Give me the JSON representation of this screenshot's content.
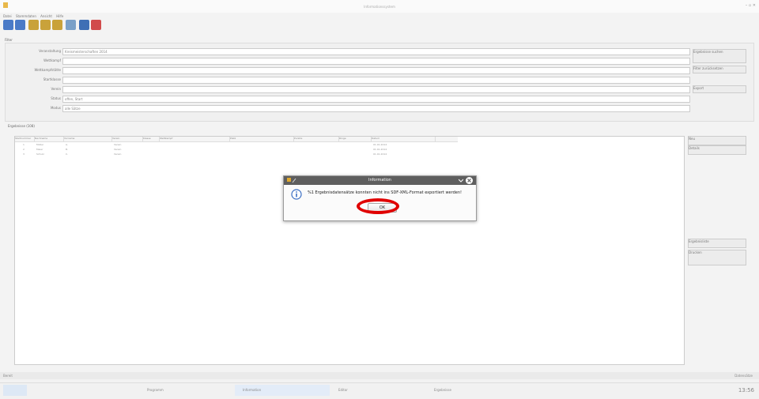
{
  "window": {
    "title": "Informationssystem",
    "controls": "– ▫ ✕"
  },
  "menu": {
    "items": [
      "Datei",
      "Stammdaten",
      "Ansicht",
      "Hilfe"
    ]
  },
  "toolbar": {
    "icons": [
      "arrow-left-icon",
      "arrow-right-icon",
      "trophy-icon",
      "trophy-icon",
      "trophy-icon",
      "edit-icon",
      "save-icon",
      "delete-icon"
    ]
  },
  "filter": {
    "section_label": "Filter",
    "fields": [
      {
        "label": "Veranstaltung",
        "value": "Kreismeisterschaften 2014"
      },
      {
        "label": "Wettkampf",
        "value": ""
      },
      {
        "label": "Wettkampfstätte",
        "value": ""
      },
      {
        "label": "Startklasse",
        "value": ""
      },
      {
        "label": "Verein",
        "value": ""
      },
      {
        "label": "Status",
        "value": "offen, Start"
      },
      {
        "label": "Modus",
        "value": "alle Sätze"
      }
    ]
  },
  "right_buttons": {
    "search": "Ergebnisse suchen",
    "reset": "Filter zurücksetzen",
    "export": "Export",
    "new": "Neu",
    "details": "Details",
    "result_list": "Ergebnisliste",
    "print": "Drucken"
  },
  "results": {
    "section_label": "Ergebnisse (108)",
    "columns": [
      "Startnummer",
      "Nachname",
      "Vorname",
      "Verein",
      "Klasse",
      "Wettkampf",
      "Platz",
      "Punkte",
      "Ringe",
      "Datum"
    ],
    "rows": [
      [
        "1",
        "Müller",
        "A.",
        "Verein",
        "",
        "",
        "",
        "",
        "",
        "01.01.2014"
      ],
      [
        "2",
        "Meier",
        "B.",
        "Verein",
        "",
        "",
        "",
        "",
        "",
        "01.01.2014"
      ],
      [
        "3",
        "Schulz",
        "C.",
        "Verein",
        "",
        "",
        "",
        "",
        "",
        "01.01.2014"
      ]
    ]
  },
  "status": {
    "left": "Bereit",
    "right": "Datensätze"
  },
  "taskbar": {
    "items": [
      "Programm",
      "Information",
      "Editor",
      "Ergebnisse"
    ],
    "clock": "13:56"
  },
  "dialog": {
    "title": "Information",
    "icon": "info-icon",
    "message": "%1 Ergebnisdatensätze konnten nicht ins SDF-XML-Format exportiert werden!",
    "ok_label": "OK",
    "highlight_color": "#e00000"
  }
}
